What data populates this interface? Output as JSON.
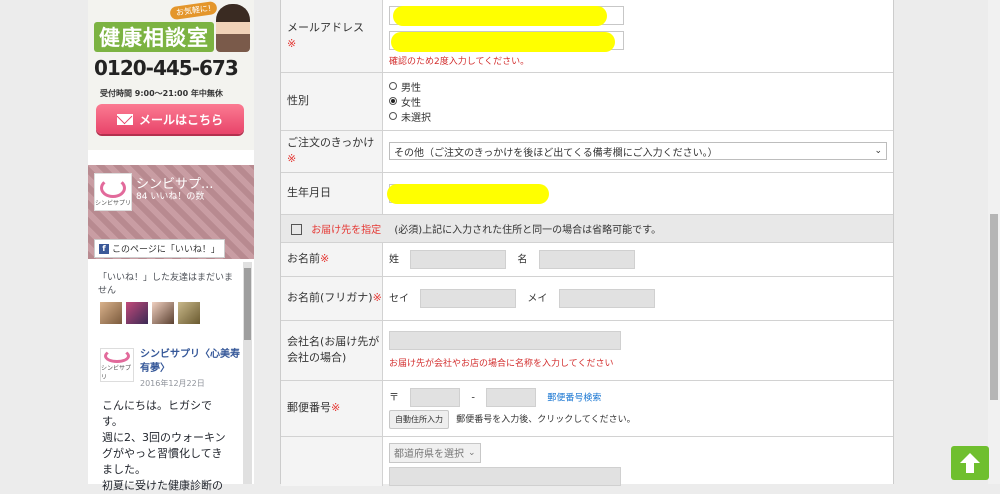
{
  "sidebar": {
    "promo": {
      "badge": "お気軽に!",
      "title": "健康相談室",
      "phone": "0120-445-673",
      "hours": "受付時間 9:00～21:00 年中無休",
      "mail_button": "メールはこちら"
    },
    "facebook": {
      "page_name": "シンビサプ...",
      "likes": "84 いいね！の数",
      "logo_text": "シンビサプリ",
      "like_button": "このページに「いいね！」",
      "friends_text": "「いいね！」した友達はまだいません"
    },
    "post": {
      "author": "シンビサプリ〈心美寿有夢〉",
      "date": "2016年12月22日",
      "logo_text": "シンビサプリ",
      "body": "こんにちは。ヒガシです。\n週に2、3回のウォーキングがやっと習慣化してきました。\n初夏に受けた健康診断の"
    }
  },
  "form": {
    "email": {
      "label": "メールアドレス",
      "required": "※",
      "note": "確認のため2度入力してください。"
    },
    "gender": {
      "label": "性別",
      "options": [
        "男性",
        "女性",
        "未選択"
      ],
      "selected": "女性"
    },
    "reason": {
      "label": "ご注文のきっかけ",
      "required": "※",
      "selected": "その他（ご注文のきっかけを後ほど出てくる備考欄にご入力ください。）"
    },
    "birthday": {
      "label": "生年月日"
    },
    "delivery": {
      "link": "お届け先を指定",
      "note": "(必須)上記に入力された住所と同一の場合は省略可能です。"
    },
    "name": {
      "label": "お名前",
      "required": "※",
      "sei": "姓",
      "mei": "名"
    },
    "kana": {
      "label": "お名前(フリガナ)",
      "required": "※",
      "sei": "セイ",
      "mei": "メイ"
    },
    "company": {
      "label": "会社名(お届け先が会社の場合)",
      "note": "お届け先が会社やお店の場合に名称を入力してください"
    },
    "postal": {
      "label": "郵便番号",
      "required": "※",
      "symbol": "〒",
      "dash": "-",
      "search_link": "郵便番号検索",
      "auto_button": "自動住所入力",
      "auto_note": "郵便番号を入力後、クリックしてください。"
    },
    "prefecture": {
      "placeholder": "都道府県を選択"
    }
  },
  "colors": {
    "accent_green": "#6fbf2e",
    "required_red": "#e53935",
    "highlight": "#ffff00"
  },
  "icons": {
    "back_to_top": "arrow-up-icon"
  }
}
